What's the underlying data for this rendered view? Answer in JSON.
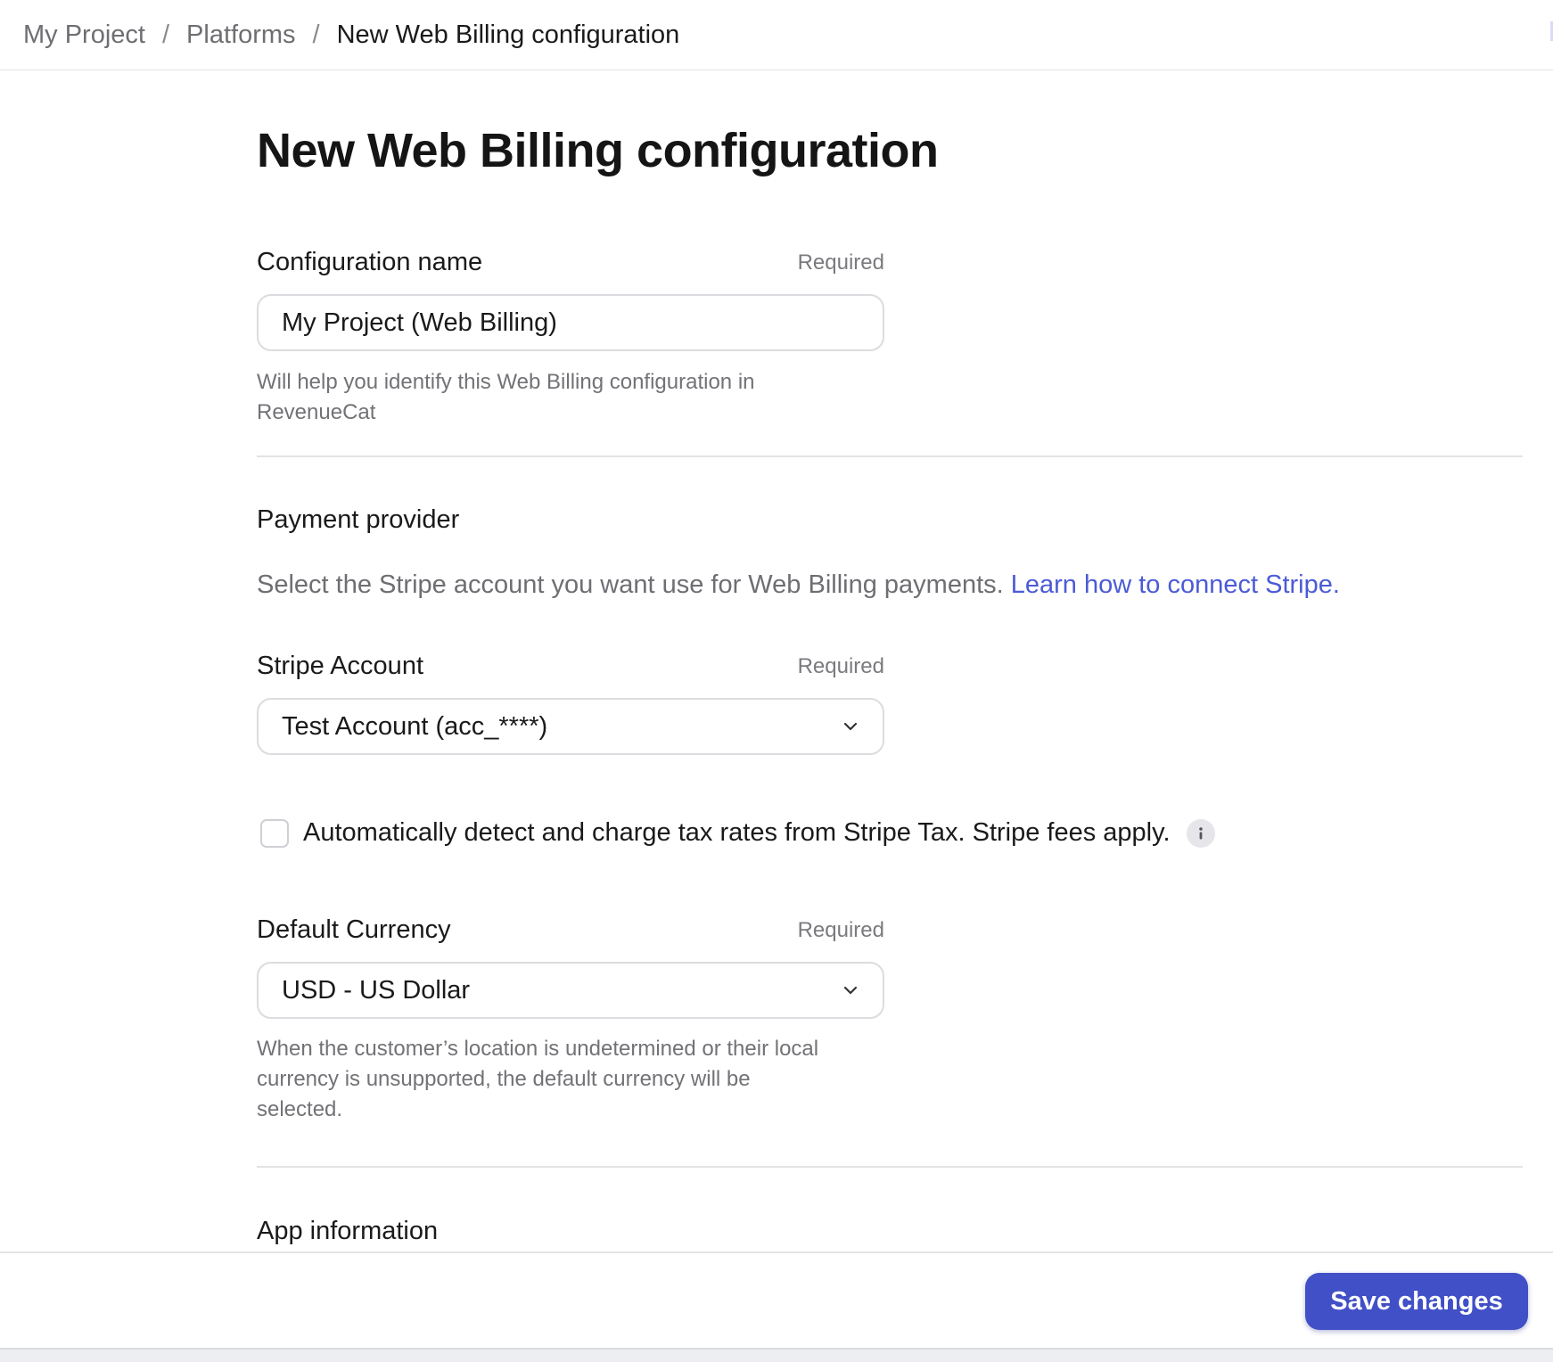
{
  "breadcrumb": {
    "items": [
      "My Project",
      "Platforms"
    ],
    "separator": "/",
    "current": "New Web Billing configuration"
  },
  "page": {
    "title": "New Web Billing configuration"
  },
  "config_name": {
    "label": "Configuration name",
    "required": "Required",
    "value": "My Project (Web Billing)",
    "help_line1": "Will help you identify this Web Billing configuration in",
    "help_line2": "RevenueCat"
  },
  "payment_provider": {
    "title": "Payment provider",
    "description": "Select the Stripe account you want use for Web Billing payments. ",
    "link_text": "Learn how to connect Stripe."
  },
  "stripe_account": {
    "label": "Stripe Account",
    "required": "Required",
    "selected": "Test Account (acc_****)"
  },
  "tax_checkbox": {
    "label": "Automatically detect and charge tax rates from Stripe Tax. Stripe fees apply.",
    "checked": false
  },
  "default_currency": {
    "label": "Default Currency",
    "required": "Required",
    "selected": "USD - US Dollar",
    "help_line1": "When the customer’s location is undetermined or their local",
    "help_line2": "currency is unsupported, the default currency will be",
    "help_line3": "selected."
  },
  "app_information": {
    "title": "App information"
  },
  "footer": {
    "save_label": "Save changes"
  },
  "colors": {
    "accent": "#4150c7",
    "link": "#4b5bd6"
  },
  "icons": {
    "select_chevron": "chevron-down-icon",
    "info": "info-icon"
  }
}
